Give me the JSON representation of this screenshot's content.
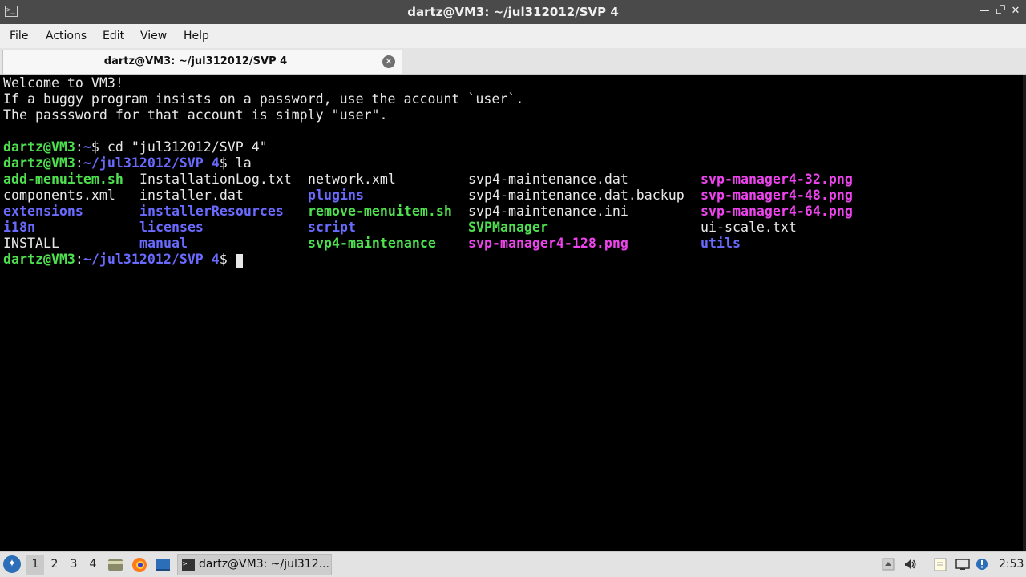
{
  "window": {
    "title": "dartz@VM3: ~/jul312012/SVP 4",
    "icon": "terminal-icon",
    "controls": [
      "minimize-icon",
      "maximize-icon",
      "close-icon"
    ]
  },
  "menu": {
    "file": "File",
    "actions": "Actions",
    "edit": "Edit",
    "view": "View",
    "help": "Help"
  },
  "tab": {
    "label": "dartz@VM3: ~/jul312012/SVP 4",
    "close_icon": "close-circle-icon"
  },
  "terminal": {
    "welcome": "Welcome to VM3!",
    "note1": "If a buggy program insists on a password, use the account `user`.",
    "note2": "The passsword for that account is simply \"user\".",
    "prompt1": {
      "user": "dartz@VM3",
      "path": "~",
      "cmd": " cd \"jul312012/SVP 4\""
    },
    "prompt2": {
      "user": "dartz@VM3",
      "path": "~/jul312012/SVP 4",
      "cmd": " la"
    },
    "prompt3": {
      "user": "dartz@VM3",
      "path": "~/jul312012/SVP 4",
      "cmd": " "
    },
    "ls": {
      "col1": [
        "add-menuitem.sh",
        "components.xml",
        "extensions",
        "i18n",
        "INSTALL"
      ],
      "col2": [
        "InstallationLog.txt",
        "installer.dat",
        "installerResources",
        "licenses",
        "manual"
      ],
      "col3": [
        "network.xml",
        "plugins",
        "remove-menuitem.sh",
        "script",
        "svp4-maintenance"
      ],
      "col4": [
        "svp4-maintenance.dat",
        "svp4-maintenance.dat.backup",
        "svp4-maintenance.ini",
        "SVPManager",
        "svp-manager4-128.png"
      ],
      "col5": [
        "svp-manager4-32.png",
        "svp-manager4-48.png",
        "svp-manager4-64.png",
        "ui-scale.txt",
        "utils"
      ]
    },
    "colors": {
      "exec": "#4fe04f",
      "dir": "#6a6aff",
      "image": "#ee44ee",
      "plain": "#e8e8e8",
      "prompt_user": "#4fe04f",
      "prompt_path": "#6a6aff"
    }
  },
  "taskbar": {
    "workspaces": [
      "1",
      "2",
      "3",
      "4"
    ],
    "active_workspace": "1",
    "quicklaunch": [
      "file-manager-icon",
      "firefox-icon",
      "desktop-icon"
    ],
    "task_label": "dartz@VM3: ~/jul312...",
    "tray": [
      "tray-arrow-icon",
      "volume-icon",
      "notes-icon",
      "network-icon",
      "update-icon"
    ],
    "clock": "2:53"
  }
}
